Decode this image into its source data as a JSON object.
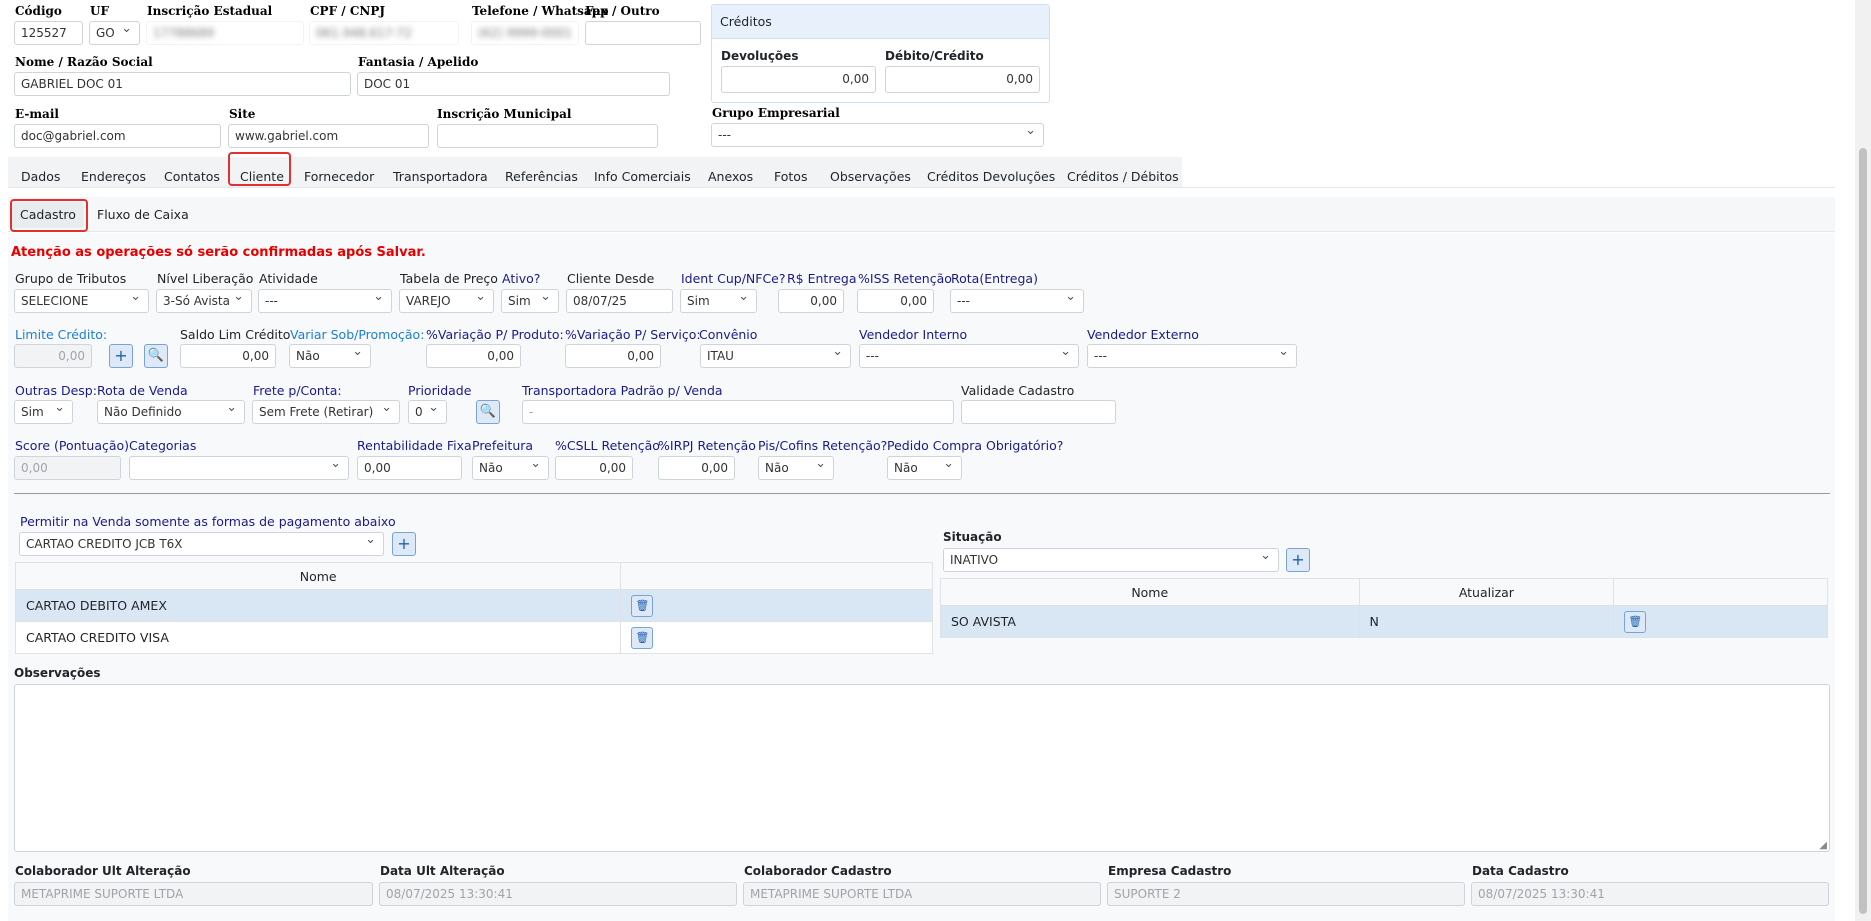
{
  "header": {
    "codigo_label": "Código",
    "codigo_value": "125527",
    "uf_label": "UF",
    "uf_value": "GO",
    "ie_label": "Inscrição Estadual",
    "ie_value": "17788689",
    "cpf_label": "CPF / CNPJ",
    "cpf_value": "061.948.617-72",
    "telefone_label": "Telefone / Whatsapp",
    "telefone_value": "(62) 9999-0001",
    "fax_label": "Fax / Outro",
    "fax_value": "",
    "nome_label": "Nome / Razão Social",
    "nome_value": "GABRIEL DOC 01",
    "fantasia_label": "Fantasia / Apelido",
    "fantasia_value": "DOC 01",
    "email_label": "E-mail",
    "email_value": "doc@gabriel.com",
    "site_label": "Site",
    "site_value": "www.gabriel.com",
    "im_label": "Inscrição Municipal",
    "im_value": ""
  },
  "creditos": {
    "title": "Créditos",
    "devolucoes_label": "Devoluções",
    "devolucoes_value": "0,00",
    "debito_label": "Débito/Crédito",
    "debito_value": "0,00",
    "grupo_label": "Grupo Empresarial",
    "grupo_value": "---"
  },
  "tabs": [
    "Dados",
    "Endereços",
    "Contatos",
    "Cliente",
    "Fornecedor",
    "Transportadora",
    "Referências",
    "Info Comerciais",
    "Anexos",
    "Fotos",
    "Observações",
    "Créditos Devoluções",
    "Créditos / Débitos"
  ],
  "subtabs": [
    "Cadastro",
    "Fluxo de Caixa"
  ],
  "warning": "Atenção as operações só serão confirmadas após Salvar.",
  "row1": {
    "grupo_tributos_label": "Grupo de Tributos",
    "grupo_tributos_value": "SELECIONE",
    "nivel_label": "Nível Liberação",
    "nivel_value": "3-Só Avista",
    "atividade_label": "Atividade",
    "atividade_value": "---",
    "tabela_label": "Tabela de Preço",
    "tabela_value": "VAREJO",
    "ativo_label": "Ativo?",
    "ativo_value": "Sim",
    "cliente_desde_label": "Cliente Desde",
    "cliente_desde_value": "08/07/25",
    "ident_label": "Ident Cup/NFCe?",
    "ident_value": "Sim",
    "entrega_label": "R$ Entrega",
    "entrega_value": "0,00",
    "iss_label": "%ISS Retenção",
    "iss_value": "0,00",
    "rota_label": "Rota(Entrega)",
    "rota_value": "---"
  },
  "row2": {
    "limite_label": "Limite Crédito:",
    "limite_value": "0,00",
    "saldo_label": "Saldo Lim Crédito",
    "saldo_value": "0,00",
    "variar_label": "Variar Sob/Promoção:",
    "variar_value": "Não",
    "var_prod_label": "%Variação P/ Produto:",
    "var_prod_value": "0,00",
    "var_serv_label": "%Variação P/ Serviço:",
    "var_serv_value": "0,00",
    "convenio_label": "Convênio",
    "convenio_value": "ITAU",
    "vend_int_label": "Vendedor Interno",
    "vend_int_value": "---",
    "vend_ext_label": "Vendedor Externo",
    "vend_ext_value": "---"
  },
  "row3": {
    "outras_label": "Outras Desp:",
    "outras_value": "Sim",
    "rota_venda_label": "Rota de Venda",
    "rota_venda_value": "Não Definido",
    "frete_label": "Frete p/Conta:",
    "frete_value": "Sem Frete (Retirar)",
    "prioridade_label": "Prioridade",
    "prioridade_value": "0",
    "transp_label": "Transportadora Padrão p/ Venda",
    "transp_value": "-",
    "validade_label": "Validade Cadastro",
    "validade_value": ""
  },
  "row4": {
    "score_label": "Score (Pontuação)",
    "score_value": "0,00",
    "categorias_label": "Categorias",
    "categorias_value": "",
    "rent_label": "Rentabilidade Fixa",
    "rent_value": "0,00",
    "prefeitura_label": "Prefeitura",
    "prefeitura_value": "Não",
    "csll_label": "%CSLL Retenção",
    "csll_value": "0,00",
    "irpj_label": "%IRPJ Retenção",
    "irpj_value": "0,00",
    "pis_label": "Pis/Cofins Retenção?",
    "pis_value": "Não",
    "pedido_label": "Pedido Compra Obrigatório?",
    "pedido_value": "Não"
  },
  "pagamentos": {
    "label": "Permitir na Venda somente as formas de pagamento abaixo",
    "select_value": "CARTAO CREDITO JCB T6X",
    "col_nome": "Nome",
    "rows": [
      "CARTAO DEBITO AMEX",
      "CARTAO CREDITO VISA"
    ]
  },
  "situacao": {
    "label": "Situação",
    "select_value": "INATIVO",
    "col_nome": "Nome",
    "col_atualizar": "Atualizar",
    "rows": [
      {
        "nome": "SO AVISTA",
        "atualizar": "N"
      }
    ]
  },
  "observacoes_label": "Observações",
  "footer": {
    "colab_alt_label": "Colaborador Ult Alteração",
    "colab_alt_value": "METAPRIME SUPORTE LTDA",
    "data_alt_label": "Data Ult Alteração",
    "data_alt_value": "08/07/2025 13:30:41",
    "colab_cad_label": "Colaborador Cadastro",
    "colab_cad_value": "METAPRIME SUPORTE LTDA",
    "empresa_label": "Empresa Cadastro",
    "empresa_value": "SUPORTE 2",
    "data_cad_label": "Data Cadastro",
    "data_cad_value": "08/07/2025 13:30:41"
  },
  "colors": {
    "accent": "#1c7ed6",
    "warning": "#e60000",
    "highlight_box": "#e03131",
    "selected_row": "#d9e7f5"
  }
}
